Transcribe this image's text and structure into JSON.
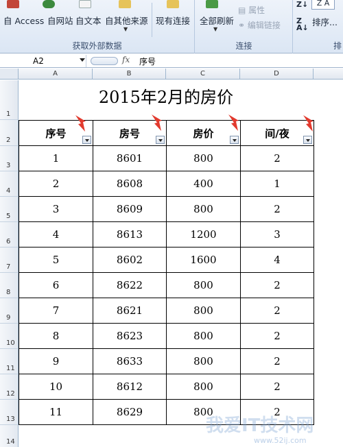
{
  "ribbon": {
    "group_external_data": {
      "label": "获取外部数据",
      "buttons": [
        "自 Access",
        "自网站",
        "自文本",
        "自其他来源",
        "现有连接"
      ]
    },
    "group_connections": {
      "label": "连接",
      "refresh_all": "全部刷新",
      "properties": "属性",
      "edit_links": "编辑链接"
    },
    "group_sort": {
      "label": "排",
      "sort": "排序..."
    }
  },
  "formula_bar": {
    "name_box": "A2",
    "fx": "fx",
    "content": "序号"
  },
  "columns": [
    "A",
    "B",
    "C",
    "D"
  ],
  "rows": [
    "1",
    "2",
    "3",
    "4",
    "5",
    "6",
    "7",
    "8",
    "9",
    "10",
    "11",
    "12",
    "13",
    "14"
  ],
  "sheet": {
    "title": "2015年2月的房价",
    "headers": [
      "序号",
      "房号",
      "房价",
      "间/夜"
    ],
    "data": [
      [
        "1",
        "8601",
        "800",
        "2"
      ],
      [
        "2",
        "8608",
        "400",
        "1"
      ],
      [
        "3",
        "8609",
        "800",
        "2"
      ],
      [
        "4",
        "8613",
        "1200",
        "3"
      ],
      [
        "5",
        "8602",
        "1600",
        "4"
      ],
      [
        "6",
        "8622",
        "800",
        "2"
      ],
      [
        "7",
        "8621",
        "800",
        "2"
      ],
      [
        "8",
        "8623",
        "800",
        "2"
      ],
      [
        "9",
        "8633",
        "800",
        "2"
      ],
      [
        "10",
        "8612",
        "800",
        "2"
      ],
      [
        "11",
        "8629",
        "800",
        "2"
      ]
    ]
  },
  "watermark": {
    "text": "我爱IT技术网",
    "url": "www.52ij.com"
  },
  "colors": {
    "arrow": "#e23a2e",
    "ribbon_bg": "#dbe6f4"
  }
}
